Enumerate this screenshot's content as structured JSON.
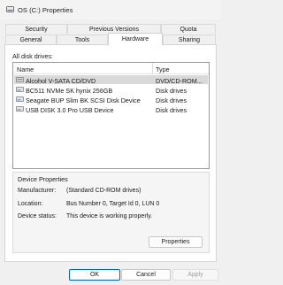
{
  "window": {
    "title": "OS (C:) Properties"
  },
  "tabs": {
    "row1": [
      "Security",
      "Previous Versions",
      "Quota"
    ],
    "row2": [
      "General",
      "Tools",
      "Hardware",
      "Sharing"
    ]
  },
  "hardware": {
    "all_disk_drives_label": "All disk drives:",
    "columns": {
      "name": "Name",
      "type": "Type"
    },
    "drives": [
      {
        "name": "Alcohol V-SATA CD/DVD",
        "type": "DVD/CD-ROM..."
      },
      {
        "name": "BC511 NVMe SK hynix 256GB",
        "type": "Disk drives"
      },
      {
        "name": "Seagate BUP Slim BK SCSI Disk Device",
        "type": "Disk drives"
      },
      {
        "name": "USB DISK 3.0 Pro USB Device",
        "type": "Disk drives"
      }
    ],
    "selected_index": 0
  },
  "device_properties": {
    "title": "Device Properties",
    "manufacturer_label": "Manufacturer:",
    "manufacturer_value": "(Standard CD-ROM drives)",
    "location_label": "Location:",
    "location_value": "Bus Number 0, Target Id 0, LUN 0",
    "status_label": "Device status:",
    "status_value": "This device is working properly.",
    "properties_button": "Properties"
  },
  "footer": {
    "ok": "OK",
    "cancel": "Cancel",
    "apply": "Apply"
  },
  "colors": {
    "selection": "#d9d9d9",
    "accent": "#0067c0"
  }
}
